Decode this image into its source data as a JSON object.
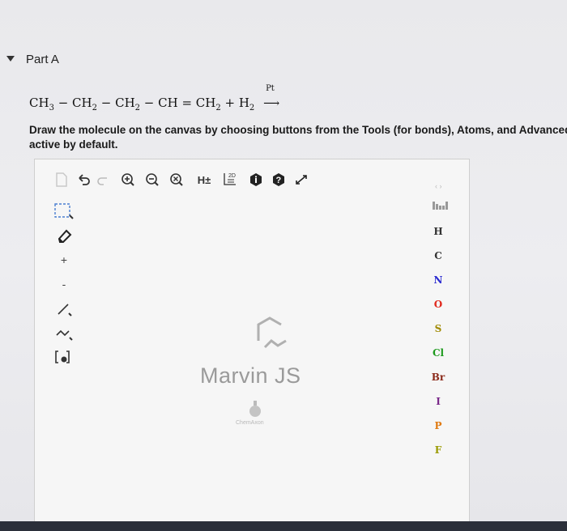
{
  "part": {
    "title": "Part A"
  },
  "equation": {
    "reactants": [
      "CH3",
      "CH2",
      "CH2",
      "CH",
      "CH2",
      "H2"
    ],
    "catalyst": "Pt"
  },
  "instructions": {
    "line1": "Draw the molecule on the canvas by choosing buttons from the Tools (for bonds), Atoms, and Advanced",
    "line2": "active by default."
  },
  "toolbar": {
    "h_toggle_label": "H±",
    "dimension_label": "2D"
  },
  "canvas": {
    "brand": "Marvin JS",
    "vendor": "ChemAxon"
  },
  "atoms": [
    "H",
    "C",
    "N",
    "O",
    "S",
    "Cl",
    "Br",
    "I",
    "P",
    "F"
  ],
  "colors": {
    "H": "#333333",
    "C": "#333333",
    "N": "#2a2ad0",
    "O": "#e0281c",
    "S": "#a08a00",
    "Cl": "#1e9a1e",
    "Br": "#8b2a1a",
    "I": "#7a2a8a",
    "P": "#e07a10",
    "F": "#9a9a00"
  }
}
